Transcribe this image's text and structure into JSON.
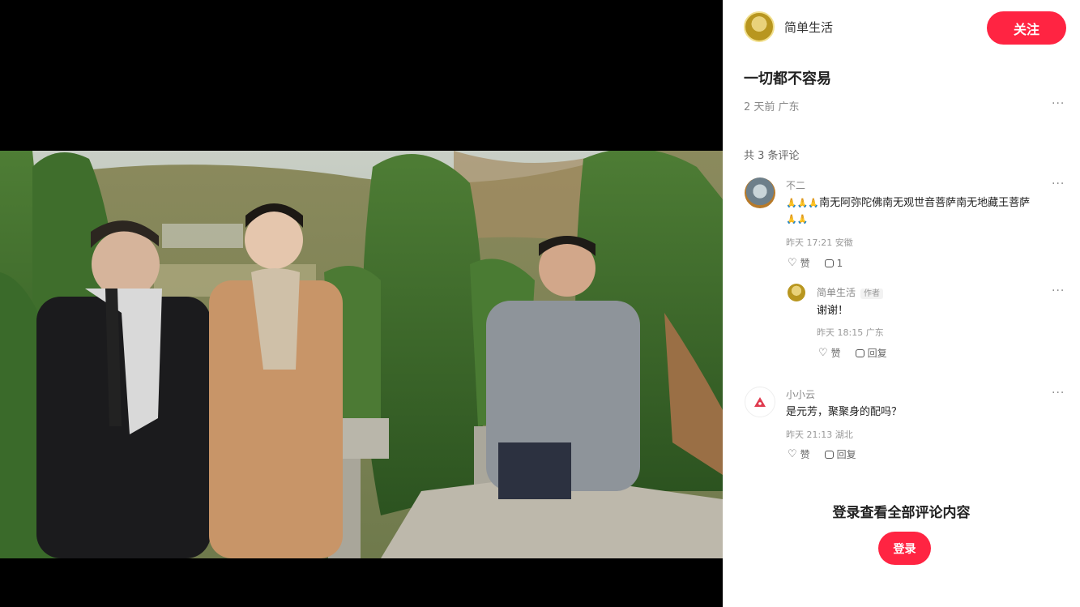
{
  "author": {
    "name": "简单生活",
    "avatar_icon": "user-avatar-icon"
  },
  "follow_label": "关注",
  "post": {
    "title": "一切都不容易",
    "meta": "2 天前 广东",
    "more": "···"
  },
  "comments_header": "共 3 条评论",
  "comments": [
    {
      "name": "不二",
      "emoji": "🙏🙏🙏",
      "text": "南无阿弥陀佛南无观世音菩萨南无地藏王菩萨",
      "emoji_tail": "🙏🙏",
      "meta": "昨天 17:21 安徽",
      "like_label": "赞",
      "reply_count": "1",
      "more": "···"
    },
    {
      "name": "简单生活",
      "tag": "作者",
      "text": "谢谢！",
      "meta": "昨天 18:15 广东",
      "like_label": "赞",
      "reply_label": "回复",
      "more": "···"
    },
    {
      "name": "小小云",
      "text": "是元芳，聚聚身的配吗？",
      "meta": "昨天 21:13 湖北",
      "like_label": "赞",
      "reply_label": "回复",
      "more": "···"
    }
  ],
  "login_hint": "登录查看全部评论内容",
  "login_label": "登录",
  "colors": {
    "accent": "#ff2442",
    "media_bg": "#000000",
    "panel_bg": "#ffffff"
  }
}
